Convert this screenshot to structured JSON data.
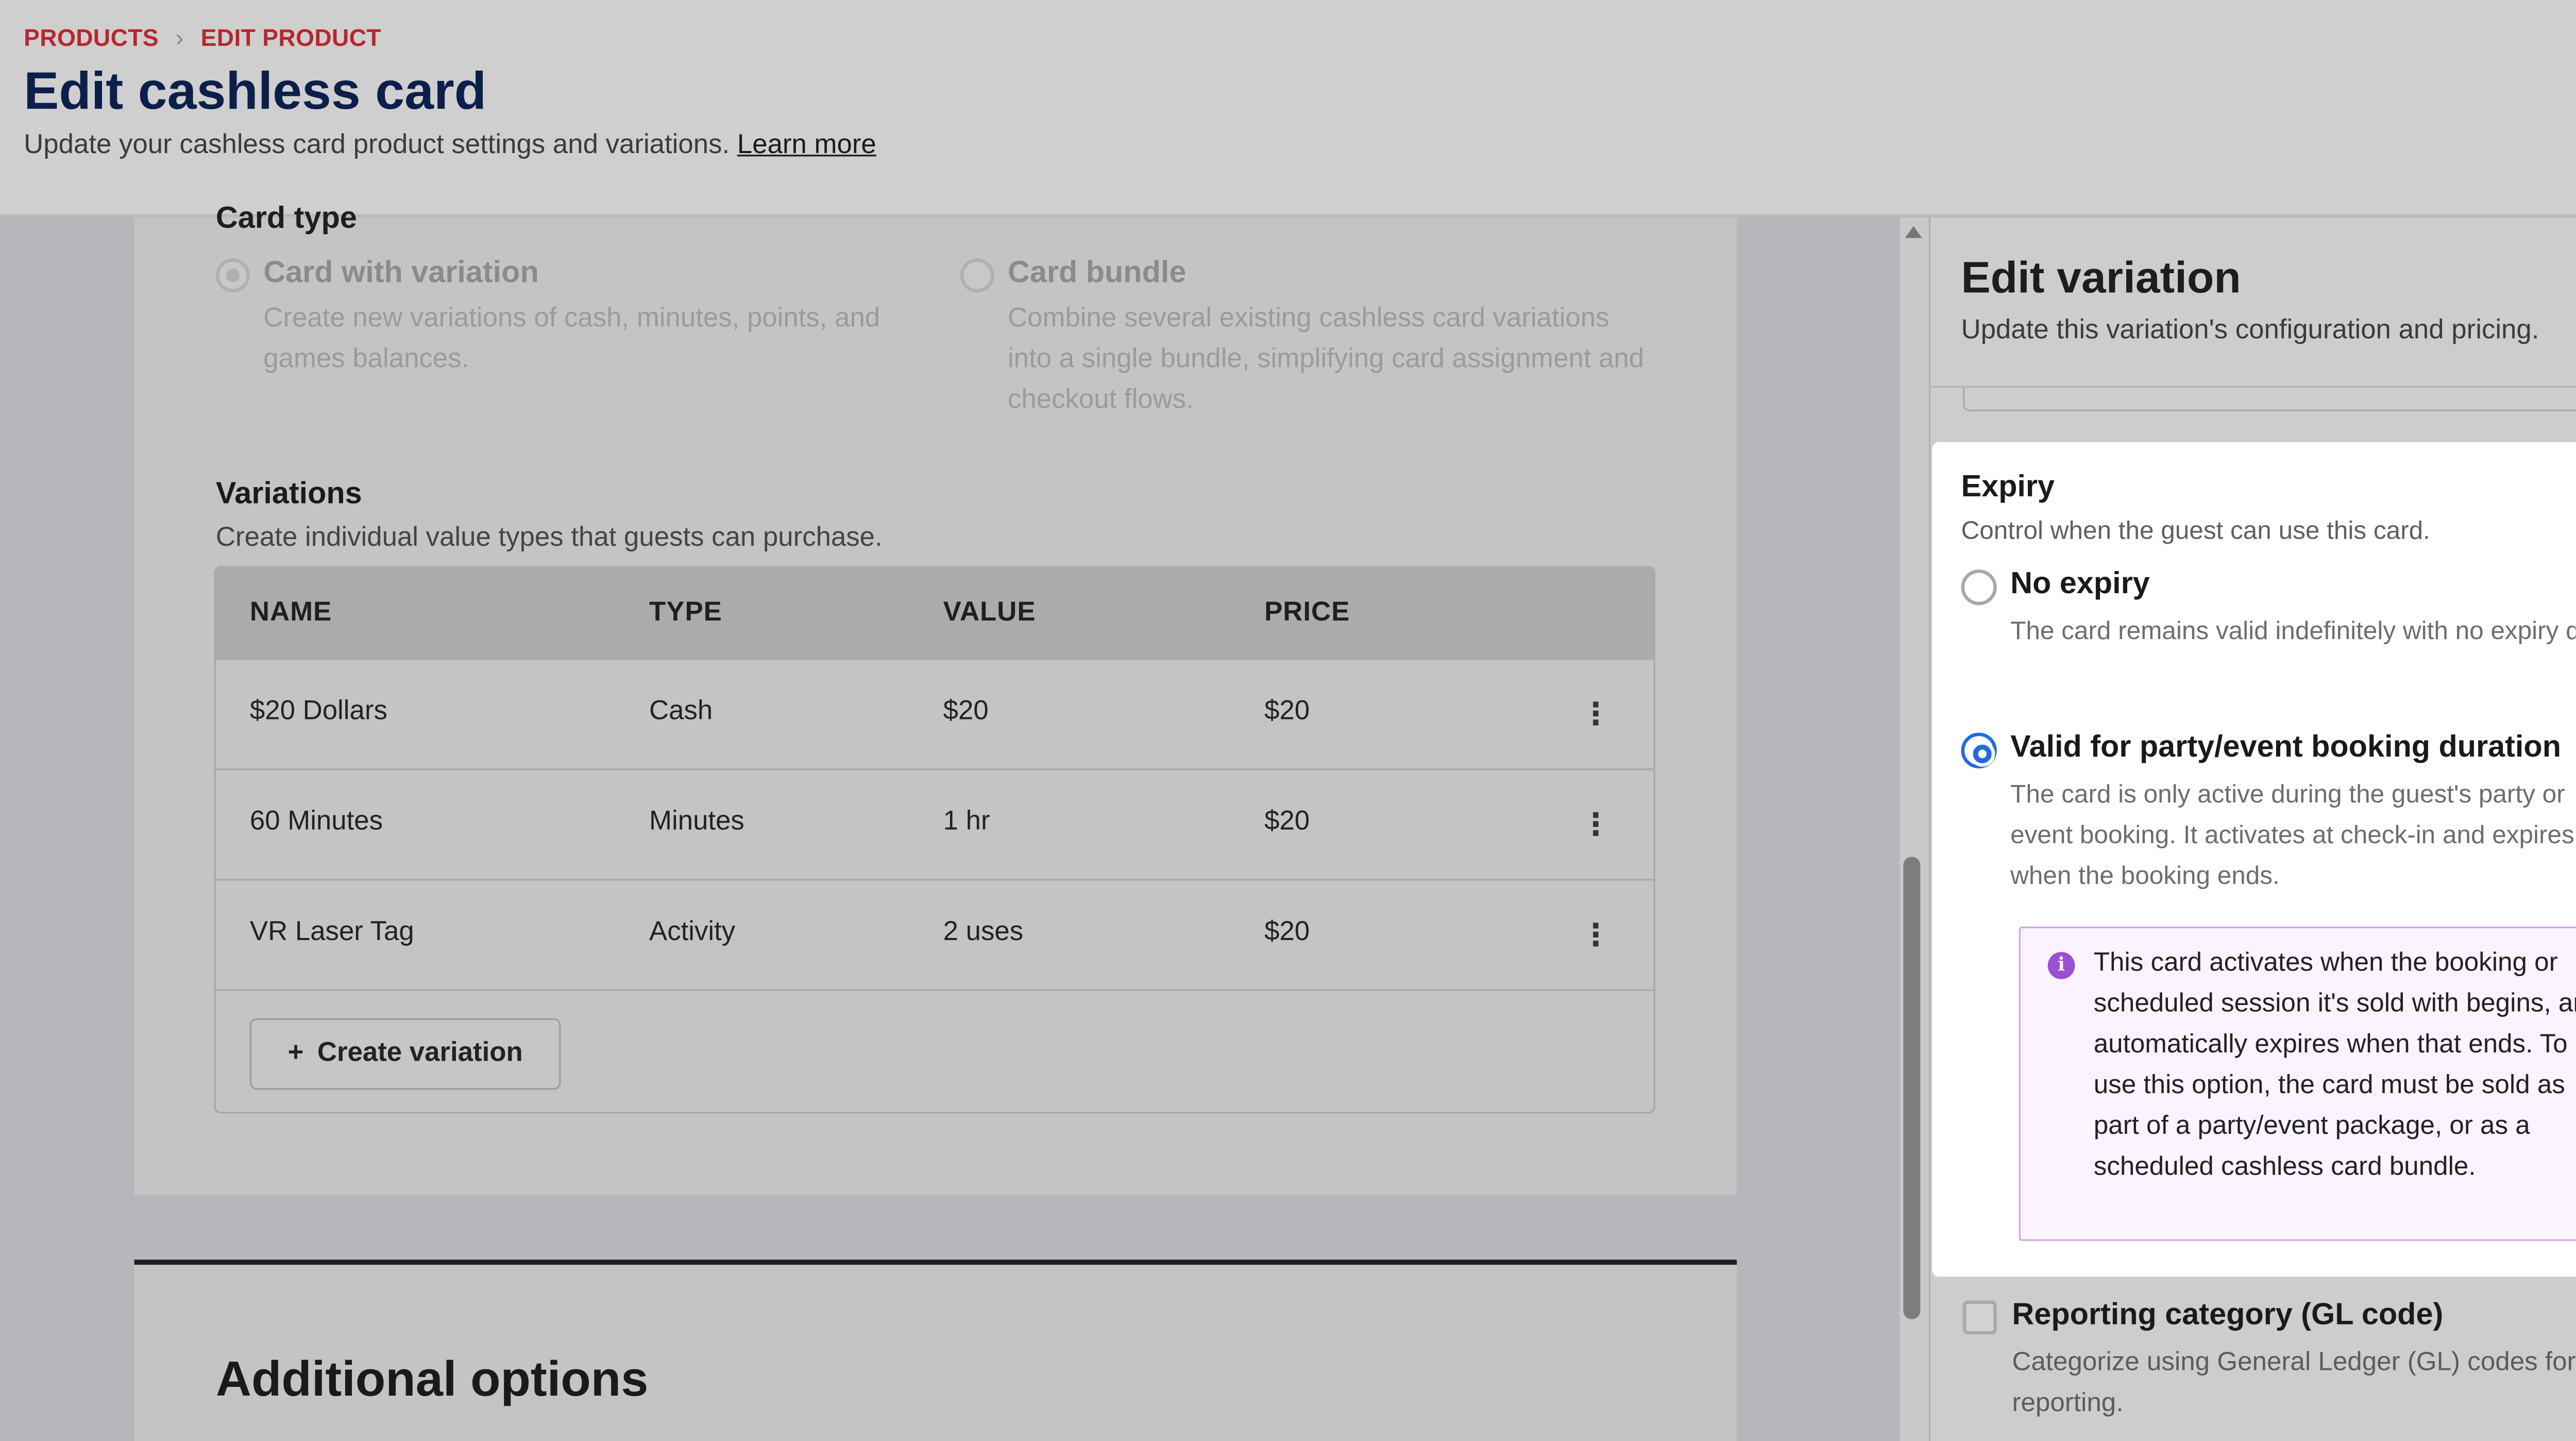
{
  "breadcrumb": [
    "PRODUCTS",
    "EDIT PRODUCT"
  ],
  "page": {
    "title": "Edit cashless card",
    "subtitle": "Update your cashless card product settings and variations.",
    "learn_more": "Learn more"
  },
  "card_type": {
    "label": "Card type",
    "options": [
      {
        "label": "Card with variation",
        "description": "Create new variations of cash, minutes, points, and games balances.",
        "selected": true
      },
      {
        "label": "Card bundle",
        "description": "Combine several existing cashless card variations into a single bundle, simplifying card assignment and checkout flows.",
        "selected": false
      }
    ]
  },
  "variations": {
    "title": "Variations",
    "subtitle": "Create individual value types that guests can purchase.",
    "columns": [
      "NAME",
      "TYPE",
      "VALUE",
      "PRICE"
    ],
    "rows": [
      {
        "name": "$20 Dollars",
        "type": "Cash",
        "value": "$20",
        "price": "$20"
      },
      {
        "name": "60 Minutes",
        "type": "Minutes",
        "value": "1 hr",
        "price": "$20"
      },
      {
        "name": "VR Laser Tag",
        "type": "Activity",
        "value": "2 uses",
        "price": "$20"
      }
    ],
    "create_button": "Create variation"
  },
  "additional_options": {
    "title": "Additional options"
  },
  "panel": {
    "title": "Edit variation",
    "subtitle": "Update this variation's configuration and pricing.",
    "close_symbol": "×"
  },
  "expiry": {
    "title": "Expiry",
    "subtitle": "Control when the guest can use this card.",
    "options": [
      {
        "label": "No expiry",
        "description": "The card remains valid indefinitely with no expiry date.",
        "selected": false
      },
      {
        "label": "Valid for party/event booking duration",
        "description": "The card is only active during the guest's party or event booking. It activates at check-in and expires when the booking ends.",
        "selected": true
      }
    ],
    "info": "This card activates when the booking or scheduled session it's sold with begins, and automatically expires when that ends. To use this option, the card must be sold as part of a party/event package, or as a scheduled cashless card bundle."
  },
  "reporting": {
    "label": "Reporting category (GL code)",
    "description": "Categorize using General Ledger (GL) codes for reporting.",
    "checked": false
  },
  "colors": {
    "breadcrumb": "#b9262c",
    "title": "#0c1f4a",
    "radio_selected": "#1f6bdf",
    "info_accent": "#9b4fd2"
  },
  "icons": [
    "chevron-right-icon",
    "kebab-menu-icon",
    "plus-icon",
    "close-icon",
    "info-icon"
  ]
}
